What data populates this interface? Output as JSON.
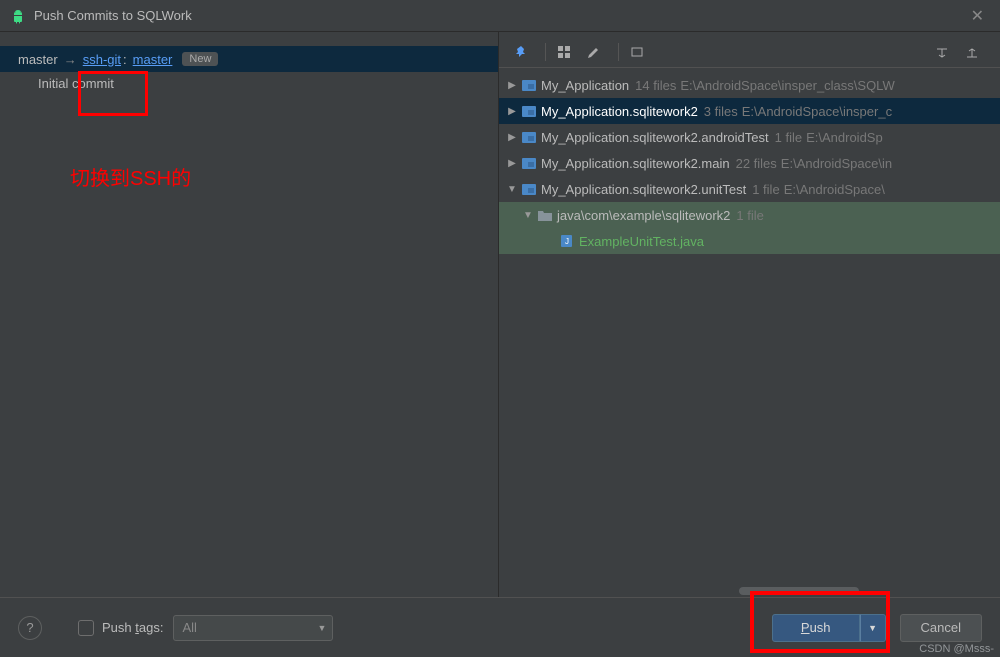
{
  "title": "Push Commits to SQLWork",
  "branch": {
    "local": "master",
    "remote": "ssh-git",
    "remote_branch": "master",
    "badge": "New"
  },
  "commit_message": "Initial commit",
  "annotation": "切换到SSH的",
  "tree": [
    {
      "name": "My_Application",
      "meta": "14 files",
      "path": "E:\\AndroidSpace\\insper_class\\SQLW",
      "expand": "right",
      "selected": false
    },
    {
      "name": "My_Application.sqlitework2",
      "meta": "3 files",
      "path": "E:\\AndroidSpace\\insper_c",
      "expand": "right",
      "selected": true
    },
    {
      "name": "My_Application.sqlitework2.androidTest",
      "meta": "1 file",
      "path": "E:\\AndroidSp",
      "expand": "right",
      "selected": false
    },
    {
      "name": "My_Application.sqlitework2.main",
      "meta": "22 files",
      "path": "E:\\AndroidSpace\\in",
      "expand": "right",
      "selected": false
    },
    {
      "name": "My_Application.sqlitework2.unitTest",
      "meta": "1 file",
      "path": "E:\\AndroidSpace\\",
      "expand": "down",
      "selected": false
    }
  ],
  "subfolder": {
    "name": "java\\com\\example\\sqlitework2",
    "meta": "1 file"
  },
  "file": {
    "name": "ExampleUnitTest.java"
  },
  "push_tags": {
    "label_prefix": "Push ",
    "label_mn": "t",
    "label_suffix": "ags:",
    "combo": "All"
  },
  "buttons": {
    "push_mn": "P",
    "push_rest": "ush",
    "cancel": "Cancel"
  },
  "watermark": "CSDN @Msss-"
}
